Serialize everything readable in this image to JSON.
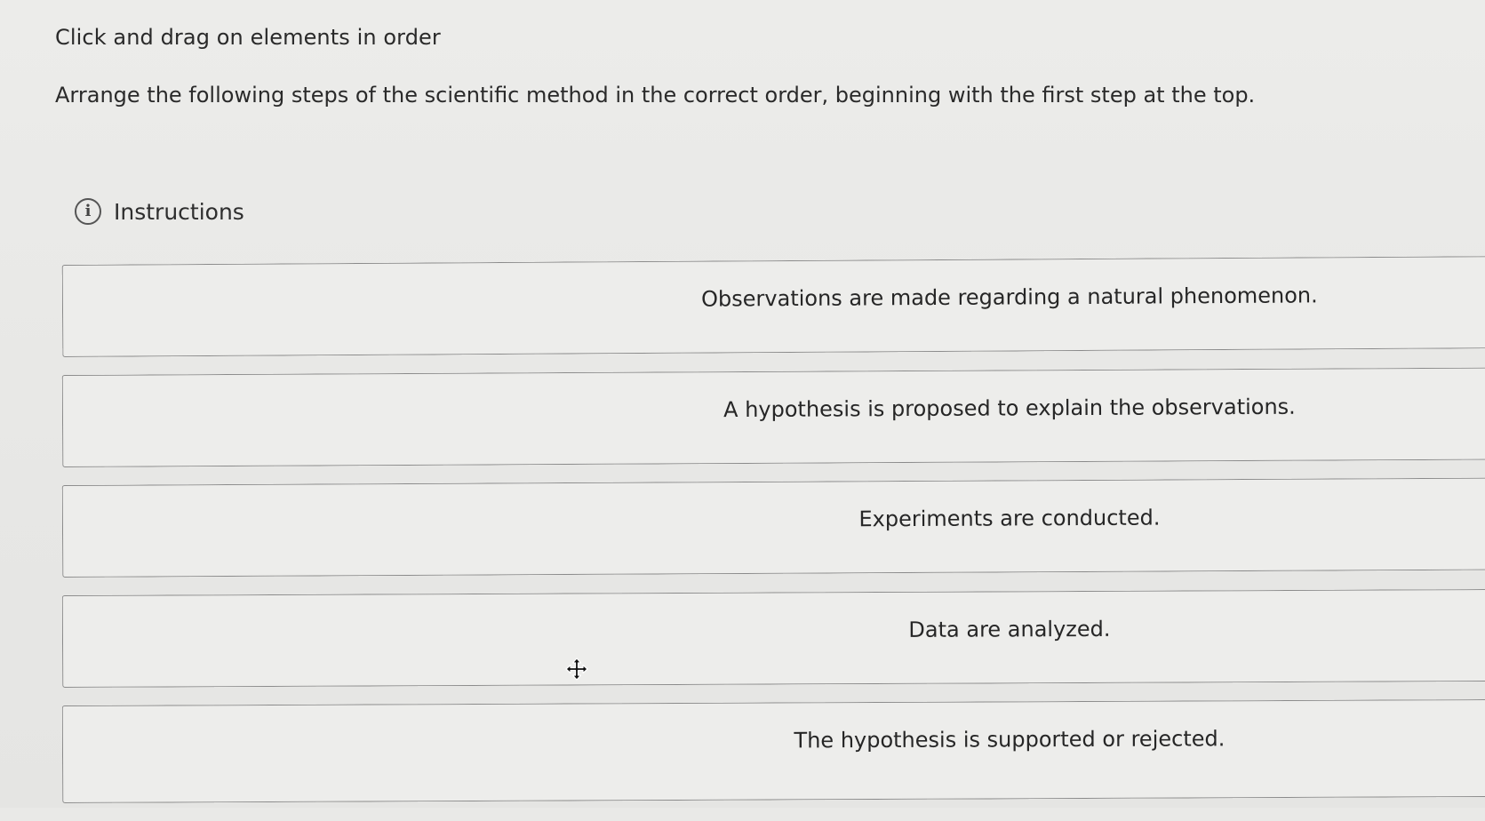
{
  "heading": "Click and drag on elements in order",
  "prompt": "Arrange the following steps of the scientific method in the correct order, beginning with the first step at the top.",
  "instructions": {
    "icon": "info-icon",
    "label": "Instructions"
  },
  "steps": [
    "Observations are made regarding a natural phenomenon.",
    "A hypothesis is proposed to explain the observations.",
    "Experiments are conducted.",
    "Data are analyzed.",
    "The hypothesis is supported or rejected."
  ],
  "cursor": "move-cursor-icon"
}
